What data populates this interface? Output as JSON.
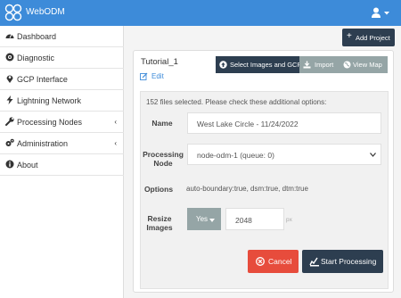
{
  "app": {
    "title": "WebODM"
  },
  "sidebar": {
    "items": [
      {
        "label": "Dashboard",
        "icon": "dashboard-icon",
        "has_submenu": false
      },
      {
        "label": "Diagnostic",
        "icon": "diagnostic-icon",
        "has_submenu": false
      },
      {
        "label": "GCP Interface",
        "icon": "map-marker-icon",
        "has_submenu": false
      },
      {
        "label": "Lightning Network",
        "icon": "bolt-icon",
        "has_submenu": false
      },
      {
        "label": "Processing Nodes",
        "icon": "wrench-icon",
        "has_submenu": true
      },
      {
        "label": "Administration",
        "icon": "gears-icon",
        "has_submenu": true
      },
      {
        "label": "About",
        "icon": "info-icon",
        "has_submenu": false
      }
    ],
    "chevron": "‹"
  },
  "toolbar": {
    "add_project_label": "Add Project"
  },
  "project": {
    "title": "Tutorial_1",
    "edit_label": "Edit",
    "buttons": {
      "select_images": "Select Images and GCP",
      "import": "Import",
      "view_map": "View Map"
    }
  },
  "form": {
    "note": "152 files selected. Please check these additional options:",
    "name_label": "Name",
    "name_value": "West Lake Circle - 11/24/2022",
    "node_label_line1": "Processing",
    "node_label_line2": "Node",
    "node_value": "node-odm-1 (queue: 0)",
    "options_label": "Options",
    "options_value": "auto-boundary:true, dsm:true, dtm:true",
    "resize_label_line1": "Resize",
    "resize_label_line2": "Images",
    "resize_toggle": "Yes",
    "resize_value": "2048",
    "resize_unit": "px",
    "cancel_label": "Cancel",
    "start_label": "Start Processing"
  },
  "colors": {
    "topbar": "#3d8bd9",
    "primary_dark": "#2d3e50",
    "danger": "#e74c3c",
    "neutral": "#95a5a6"
  }
}
